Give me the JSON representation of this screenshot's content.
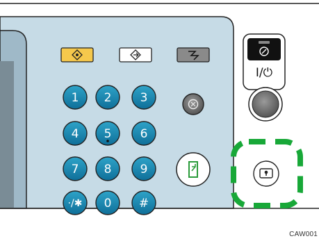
{
  "keypad": {
    "keys": [
      {
        "id": "1",
        "label": "1"
      },
      {
        "id": "2",
        "label": "2"
      },
      {
        "id": "3",
        "label": "3"
      },
      {
        "id": "4",
        "label": "4"
      },
      {
        "id": "5",
        "label": "5"
      },
      {
        "id": "6",
        "label": "6"
      },
      {
        "id": "7",
        "label": "7"
      },
      {
        "id": "8",
        "label": "8"
      },
      {
        "id": "9",
        "label": "9"
      },
      {
        "id": "star",
        "label": "·/✱"
      },
      {
        "id": "0",
        "label": "0"
      },
      {
        "id": "hash",
        "label": "#"
      }
    ]
  },
  "power": {
    "label": "I/⏻"
  },
  "caption": "CAW001"
}
